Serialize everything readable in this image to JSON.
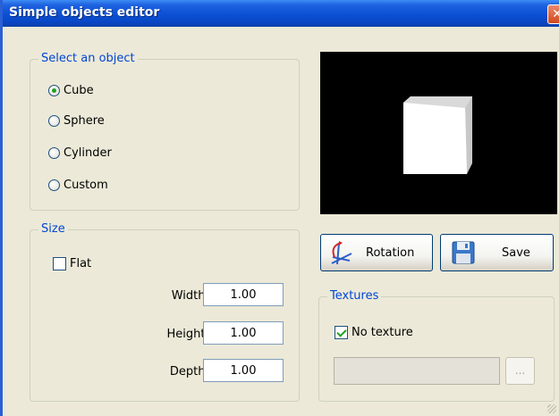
{
  "window": {
    "title": "Simple objects editor"
  },
  "select_object": {
    "legend": "Select an object",
    "options": [
      "Cube",
      "Sphere",
      "Cylinder",
      "Custom"
    ],
    "selected": "Cube"
  },
  "size": {
    "legend": "Size",
    "flat_label": "Flat",
    "flat_checked": false,
    "width_label": "Width :",
    "width_value": "1.00",
    "height_label": "Height :",
    "height_value": "1.00",
    "depth_label": "Depth :",
    "depth_value": "1.00"
  },
  "buttons": {
    "rotation": "Rotation",
    "save": "Save"
  },
  "textures": {
    "legend": "Textures",
    "no_texture_label": "No texture",
    "no_texture_checked": true,
    "browse_label": "..."
  },
  "icons": {
    "rotation": "rotation-axes-icon",
    "save": "floppy-disk-icon",
    "close": "close-icon"
  },
  "colors": {
    "title_bar": "#0b4fd4",
    "legend_text": "#0046d5",
    "radio_selected": "#21a121",
    "preview_bg": "#000000"
  }
}
